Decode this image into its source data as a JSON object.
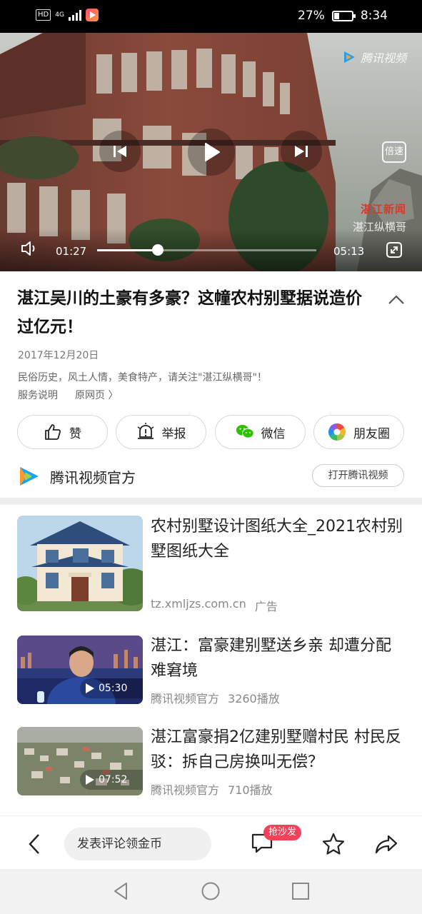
{
  "status_bar": {
    "hd": "HD",
    "network": "4G",
    "battery_percent": "27%",
    "time": "8:34"
  },
  "video": {
    "watermark": "腾讯视频",
    "speed_label": "倍速",
    "stamp_red": "湛江新闻",
    "stamp_channel": "湛江纵横哥",
    "current_time": "01:27",
    "total_time": "05:13",
    "progress_fraction": 0.278
  },
  "article": {
    "title": "湛江吴川的土豪有多豪？这幢农村别墅据说造价过亿元！",
    "date": "2017年12月20日",
    "description": "民俗历史，风土人情，美食特产，请关注\"湛江纵横哥\"！",
    "service_link": "服务说明",
    "origin_link": "原网页 〉"
  },
  "actions": [
    {
      "label": "赞",
      "icon": "thumbs-up-icon"
    },
    {
      "label": "举报",
      "icon": "report-icon"
    },
    {
      "label": "微信",
      "icon": "wechat-icon"
    },
    {
      "label": "朋友圈",
      "icon": "moments-icon"
    }
  ],
  "source": {
    "name": "腾讯视频官方",
    "open_button": "打开腾讯视频"
  },
  "related": [
    {
      "title": "农村别墅设计图纸大全_2021农村别墅图纸大全",
      "domain": "tz.xmljzs.com.cn",
      "tag": "广告"
    },
    {
      "title": "湛江：富豪建别墅送乡亲 却遭分配难窘境",
      "source": "腾讯视频官方",
      "plays": "3260播放",
      "duration": "05:30"
    },
    {
      "title": "湛江富豪捐2亿建别墅赠村民 村民反驳：拆自己房换叫无偿？",
      "source": "腾讯视频官方",
      "plays": "710播放",
      "duration": "07:52"
    }
  ],
  "bottom_bar": {
    "comment_placeholder": "发表评论领金币",
    "badge": "抢沙发"
  },
  "colors": {
    "accent_red": "#f2425a",
    "tencent_blue": "#1da1f2",
    "tencent_orange": "#ff9a2e",
    "wechat_green": "#2dc100"
  }
}
